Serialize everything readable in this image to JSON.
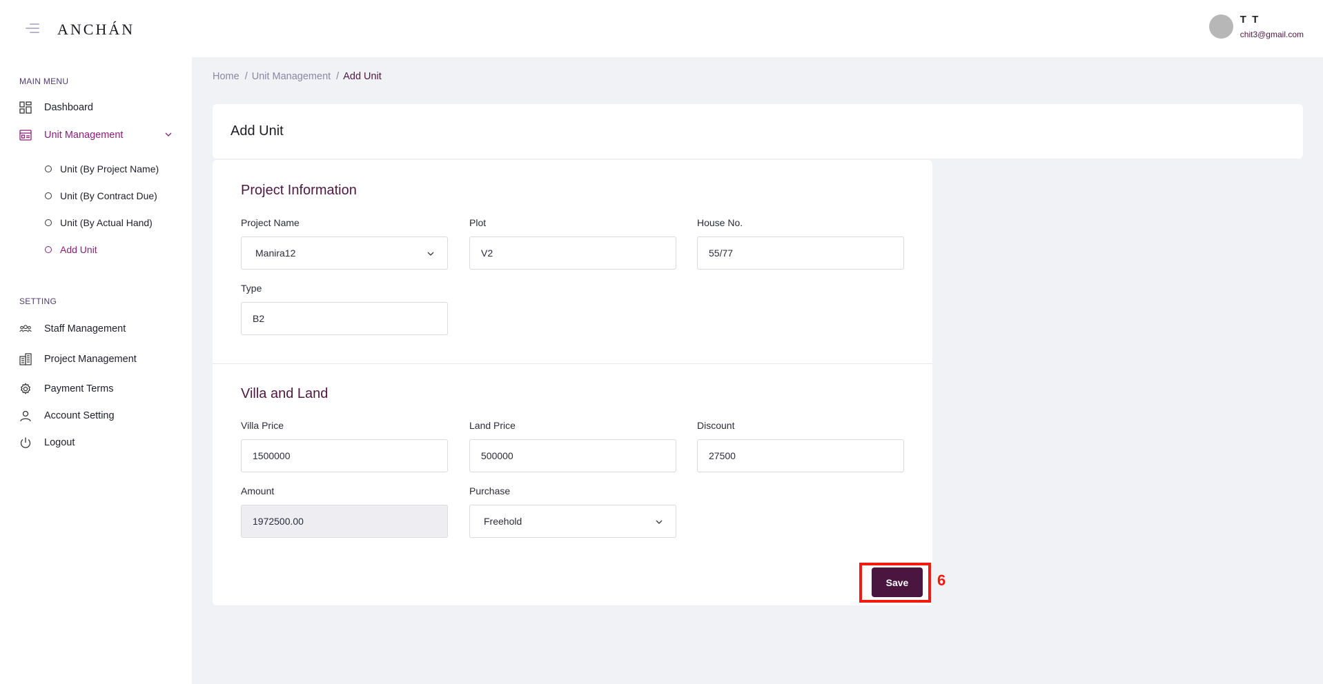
{
  "topbar": {
    "logo": "ANCHÁN",
    "user_name": "T T",
    "user_email": "chit3@gmail.com"
  },
  "sidebar": {
    "main_menu_label": "MAIN MENU",
    "dashboard": "Dashboard",
    "unit_management": "Unit Management",
    "sub_items": [
      "Unit (By Project Name)",
      "Unit (By Contract Due)",
      "Unit (By Actual Hand)",
      "Add Unit"
    ],
    "setting_label": "SETTING",
    "staff_management": "Staff Management",
    "project_management": "Project Management",
    "payment_terms": "Payment Terms",
    "account_setting": "Account Setting",
    "logout": "Logout"
  },
  "breadcrumb": {
    "home": "Home",
    "unit_management": "Unit Management",
    "current": "Add Unit"
  },
  "page_title": "Add Unit",
  "project_info": {
    "title": "Project Information",
    "project_name_label": "Project Name",
    "project_name_value": "Manira12",
    "plot_label": "Plot",
    "plot_value": "V2",
    "house_label": "House No.",
    "house_value": "55/77",
    "type_label": "Type",
    "type_value": "B2"
  },
  "villa_land": {
    "title": "Villa and Land",
    "villa_price_label": "Villa Price",
    "villa_price_value": "1500000",
    "land_price_label": "Land Price",
    "land_price_value": "500000",
    "discount_label": "Discount",
    "discount_value": "27500",
    "amount_label": "Amount",
    "amount_value": "1972500.00",
    "purchase_label": "Purchase",
    "purchase_value": "Freehold"
  },
  "save_label": "Save",
  "annotation_mark": "6",
  "colors": {
    "brand": "#4a1640",
    "active": "#8b1e78",
    "highlight": "#f2190f"
  }
}
